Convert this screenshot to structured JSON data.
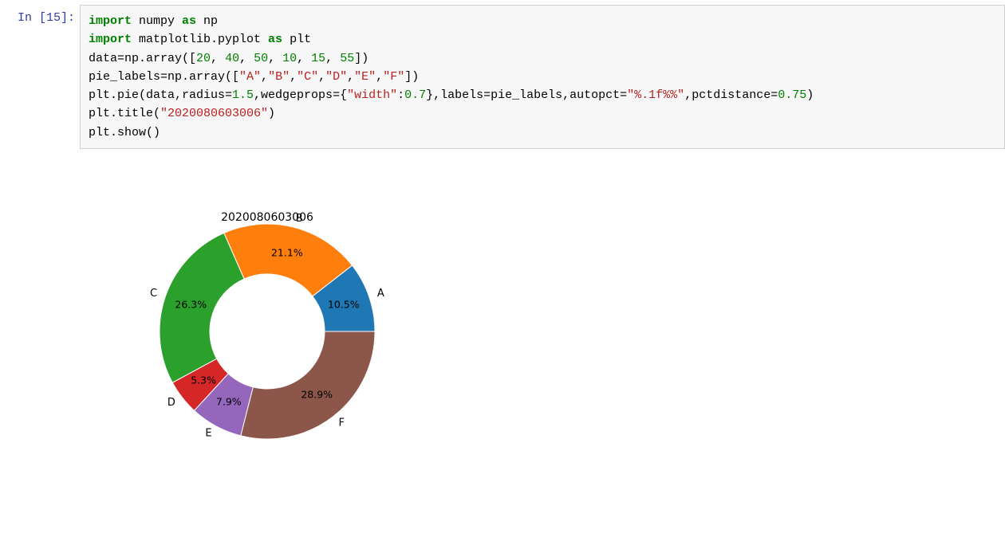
{
  "cell": {
    "prompt_in": "In ",
    "prompt_num": "[15]:",
    "code_tokens": [
      [
        "kw",
        "import"
      ],
      [
        "txt",
        " numpy "
      ],
      [
        "kw",
        "as"
      ],
      [
        "txt",
        " np\n"
      ],
      [
        "kw",
        "import"
      ],
      [
        "txt",
        " matplotlib.pyplot "
      ],
      [
        "kw",
        "as"
      ],
      [
        "txt",
        " plt\n"
      ],
      [
        "txt",
        "data=np.array(["
      ],
      [
        "num",
        "20"
      ],
      [
        "txt",
        ", "
      ],
      [
        "num",
        "40"
      ],
      [
        "txt",
        ", "
      ],
      [
        "num",
        "50"
      ],
      [
        "txt",
        ", "
      ],
      [
        "num",
        "10"
      ],
      [
        "txt",
        ", "
      ],
      [
        "num",
        "15"
      ],
      [
        "txt",
        ", "
      ],
      [
        "num",
        "55"
      ],
      [
        "txt",
        "])\n"
      ],
      [
        "txt",
        "pie_labels=np.array(["
      ],
      [
        "str",
        "\"A\""
      ],
      [
        "txt",
        ","
      ],
      [
        "str",
        "\"B\""
      ],
      [
        "txt",
        ","
      ],
      [
        "str",
        "\"C\""
      ],
      [
        "txt",
        ","
      ],
      [
        "str",
        "\"D\""
      ],
      [
        "txt",
        ","
      ],
      [
        "str",
        "\"E\""
      ],
      [
        "txt",
        ","
      ],
      [
        "str",
        "\"F\""
      ],
      [
        "txt",
        "])\n"
      ],
      [
        "txt",
        "plt.pie(data,radius="
      ],
      [
        "num",
        "1.5"
      ],
      [
        "txt",
        ",wedgeprops={"
      ],
      [
        "str",
        "\"width\""
      ],
      [
        "txt",
        ":"
      ],
      [
        "num",
        "0.7"
      ],
      [
        "txt",
        "},labels=pie_labels,autopct="
      ],
      [
        "str",
        "\"%.1f%%\""
      ],
      [
        "txt",
        ",pctdistance="
      ],
      [
        "num",
        "0.75"
      ],
      [
        "txt",
        ")\n"
      ],
      [
        "txt",
        "plt.title("
      ],
      [
        "str",
        "\"2020080603006\""
      ],
      [
        "txt",
        ")\n"
      ],
      [
        "txt",
        "plt.show()"
      ]
    ]
  },
  "chart_data": {
    "type": "pie",
    "title": "2020080603006",
    "labels": [
      "A",
      "B",
      "C",
      "D",
      "E",
      "F"
    ],
    "values": [
      20,
      40,
      50,
      10,
      15,
      55
    ],
    "percents": [
      "10.5%",
      "21.1%",
      "26.3%",
      "5.3%",
      "7.9%",
      "28.9%"
    ],
    "colors": [
      "#1f77b4",
      "#ff7f0e",
      "#2ca02c",
      "#d62728",
      "#9467bd",
      "#8c564b"
    ],
    "radius_outer": 1.5,
    "wedge_width": 0.7,
    "pctdistance": 0.75
  }
}
